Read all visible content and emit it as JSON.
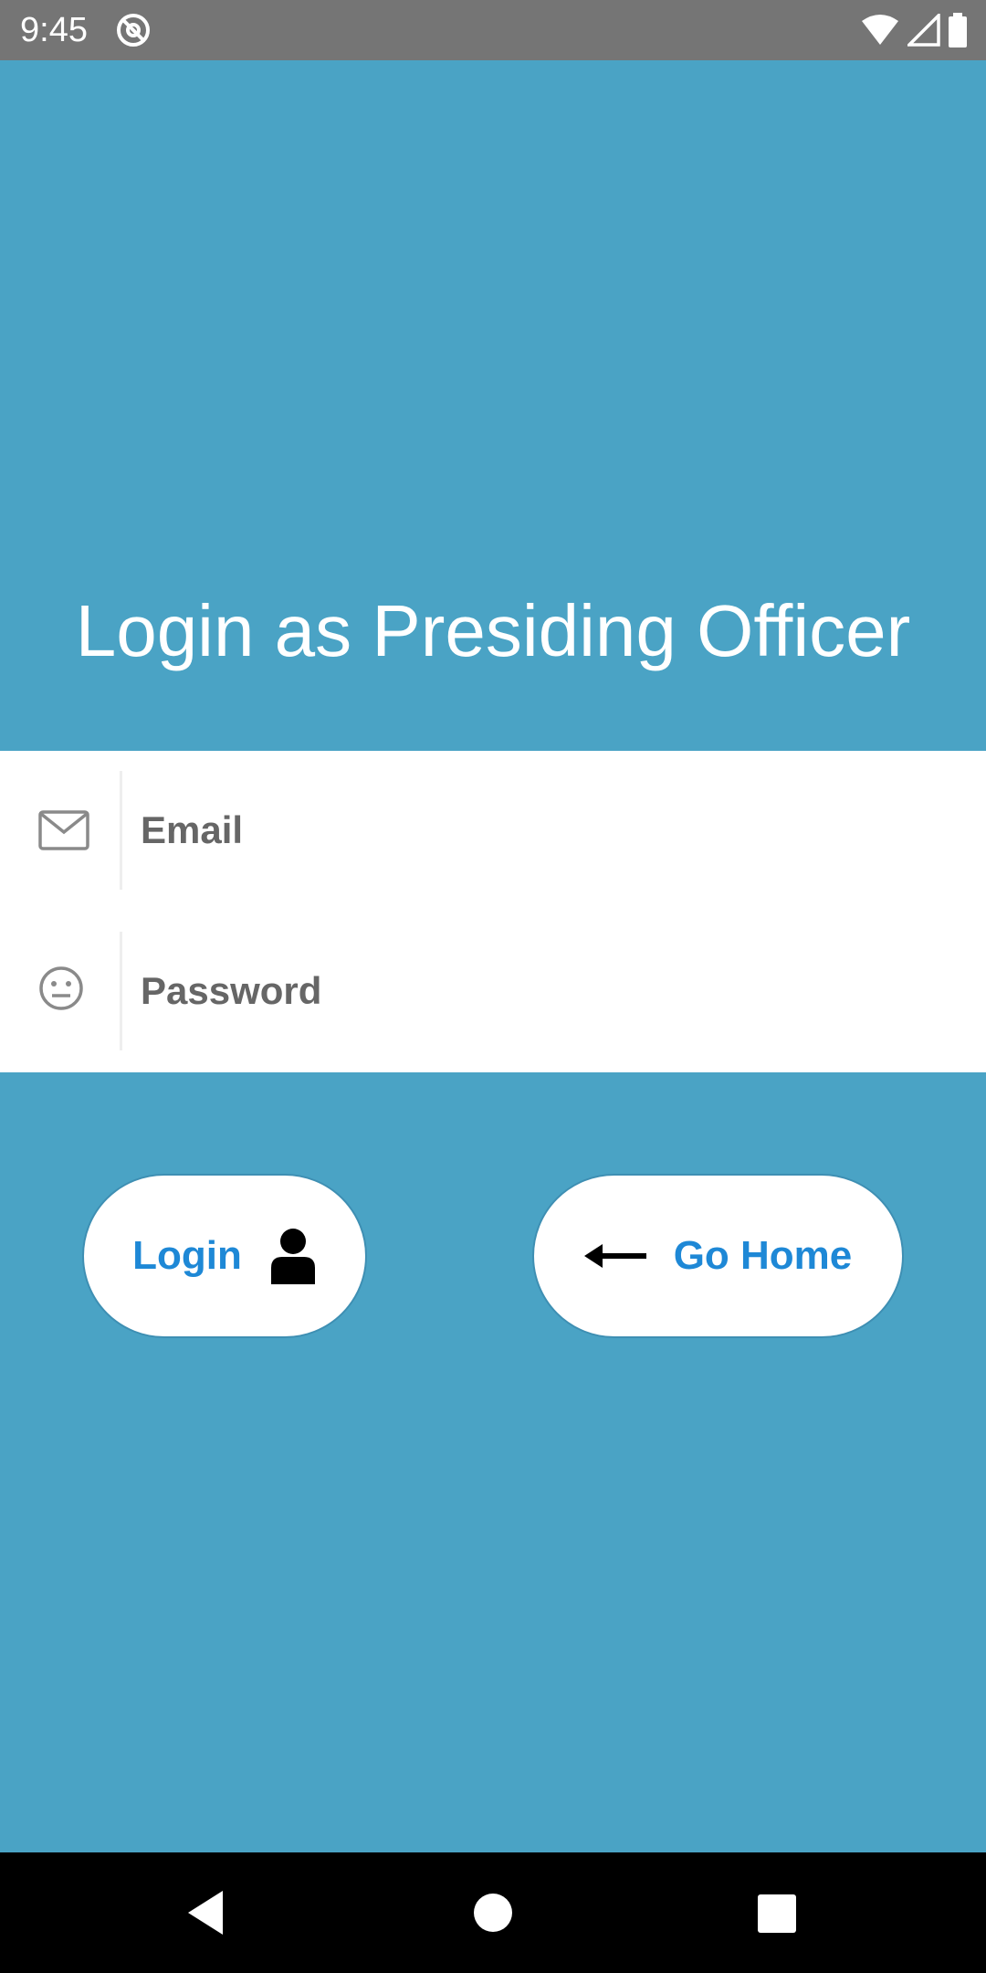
{
  "status_bar": {
    "time": "9:45",
    "app_icon": "at-sign-icon",
    "icons": [
      "wifi-icon",
      "cell-signal-icon",
      "battery-icon"
    ]
  },
  "header": {
    "title": "Login as Presiding Officer"
  },
  "form": {
    "email": {
      "icon": "envelope-icon",
      "placeholder": "Email",
      "value": ""
    },
    "password": {
      "icon": "neutral-face-icon",
      "placeholder": "Password",
      "value": ""
    }
  },
  "actions": {
    "login_label": "Login",
    "login_icon": "user-icon",
    "home_label": "Go Home",
    "home_icon": "arrow-left-icon"
  },
  "nav_bar": {
    "icons": [
      "back-triangle-icon",
      "home-circle-icon",
      "recents-square-icon"
    ]
  },
  "colors": {
    "background": "#4aa3c5",
    "status_bar": "#757575",
    "button_text": "#1e88d6",
    "placeholder": "#666666",
    "nav_bar": "#000000"
  }
}
